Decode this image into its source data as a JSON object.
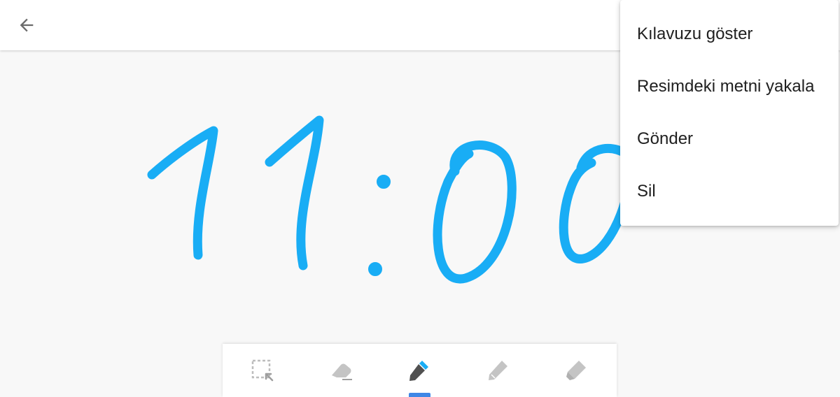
{
  "topbar": {
    "back_icon": "arrow-left-icon"
  },
  "canvas": {
    "ink_color": "#19adf5"
  },
  "menu": {
    "items": [
      {
        "label": "Kılavuzu göster"
      },
      {
        "label": "Resimdeki metni yakala"
      },
      {
        "label": "Gönder"
      },
      {
        "label": "Sil"
      }
    ]
  },
  "toolbar": {
    "tools": [
      {
        "icon": "selection-icon",
        "active": false
      },
      {
        "icon": "eraser-icon",
        "active": false
      },
      {
        "icon": "pen-icon",
        "active": true,
        "color": "#19adf5"
      },
      {
        "icon": "pencil-icon",
        "active": false
      },
      {
        "icon": "marker-icon",
        "active": false
      }
    ],
    "active_indicator_color": "#3f87e6"
  }
}
